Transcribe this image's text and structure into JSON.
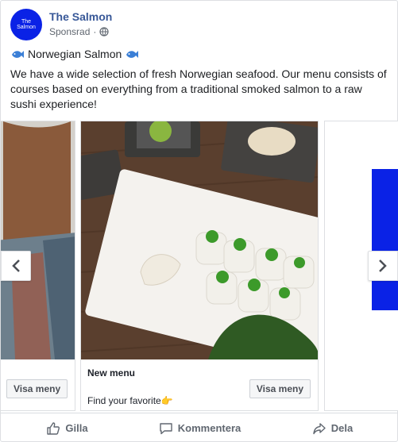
{
  "page": {
    "name": "The Salmon",
    "avatar_text_line1": "The",
    "avatar_text_line2": "Salmon",
    "sponsored": "Sponsrad",
    "brand_color": "#0a22e6",
    "name_color": "#385898"
  },
  "post": {
    "title": "Norwegian Salmon",
    "title_icons": [
      "fish-icon",
      "fish-icon"
    ],
    "body": "We have a wide selection of fresh Norwegian seafood. Our menu consists of courses based on everything from a traditional smoked salmon to a raw sushi experience!"
  },
  "carousel": {
    "cards": [
      {
        "cta": "Visa meny"
      },
      {
        "headline": "New menu",
        "description": "Find your favorite👉",
        "cta": "Visa meny"
      },
      {}
    ]
  },
  "actions": {
    "like": "Gilla",
    "comment": "Kommentera",
    "share": "Dela"
  }
}
